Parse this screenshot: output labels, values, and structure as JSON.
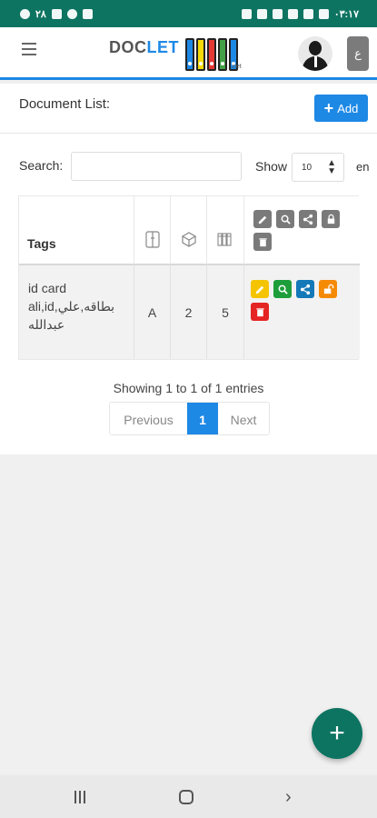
{
  "status_bar": {
    "left_text": "٢٨",
    "time": "٠٣:١٧"
  },
  "header": {
    "menu_icon": "hamburger-icon",
    "logo": {
      "doc": "DOC",
      "let": "LET",
      "suffix": ".net",
      "binder_colors": [
        "#1e88e5",
        "#f5d90a",
        "#e53935",
        "#43a047",
        "#1e88e5"
      ]
    },
    "lang_button": "ع"
  },
  "main": {
    "title": "Document List:",
    "add_button": "Add",
    "search_label": "Search:",
    "search_value": "",
    "show_label": "Show",
    "show_value": "10",
    "entries_label": "en"
  },
  "table": {
    "columns": [
      {
        "label": "Tags"
      },
      {
        "icon": "folder-icon"
      },
      {
        "icon": "box-icon"
      },
      {
        "icon": "binders-icon"
      },
      {
        "icons": [
          "edit-icon",
          "search-icon",
          "share-icon",
          "lock-icon",
          "trash-icon"
        ]
      }
    ],
    "rows": [
      {
        "tags_line1": "id card",
        "tags_line2": "ali,id,بطاقه,علي",
        "tags_line3": "عبدالله",
        "col_a": "A",
        "col_b": "2",
        "col_c": "5",
        "actions": [
          {
            "icon": "edit-icon",
            "color": "#f5c400"
          },
          {
            "icon": "search-icon",
            "color": "#1e9e3a"
          },
          {
            "icon": "share-icon",
            "color": "#1479b8"
          },
          {
            "icon": "unlock-icon",
            "color": "#f58a07"
          },
          {
            "icon": "trash-icon",
            "color": "#e52424"
          }
        ]
      }
    ]
  },
  "pagination": {
    "info": "Showing 1 to 1 of 1 entries",
    "previous": "Previous",
    "current": "1",
    "next": "Next"
  },
  "colors": {
    "accent": "#1e88e5",
    "teal": "#0d7461"
  }
}
